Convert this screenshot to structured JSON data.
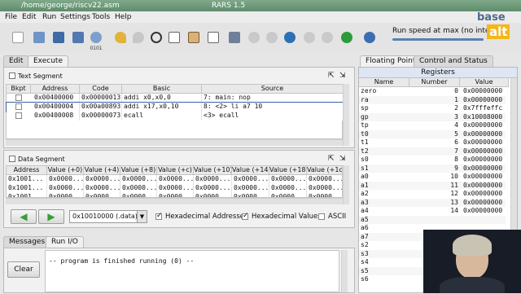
{
  "window": {
    "title": "RARS 1.5",
    "file_path": "/home/george/riscv22.asm"
  },
  "menu": [
    "File",
    "Edit",
    "Run",
    "Settings",
    "Tools",
    "Help"
  ],
  "toolbar": {
    "dump_label": "0101",
    "speed_label": "Run speed at max (no inte",
    "logo_top": "base",
    "logo_bottom": "alt"
  },
  "tabs": {
    "edit": "Edit",
    "execute": "Execute"
  },
  "text_segment": {
    "title": "Text Segment",
    "columns": [
      "Bkpt",
      "Address",
      "Code",
      "Basic",
      "Source"
    ],
    "rows": [
      {
        "address": "0x00400000",
        "code": "0x00000013",
        "basic": "addi x0,x0,0",
        "source": "7: main:   nop"
      },
      {
        "address": "0x00400004",
        "code": "0x00a00893",
        "basic": "addi x17,x0,10",
        "source": "8: <2> li  a7 10"
      },
      {
        "address": "0x00400008",
        "code": "0x00000073",
        "basic": "ecall",
        "source": "   <3> ecall"
      }
    ]
  },
  "data_segment": {
    "title": "Data Segment",
    "columns": [
      "Address",
      "Value (+0)",
      "Value (+4)",
      "Value (+8)",
      "Value (+c)",
      "Value (+10)",
      "Value (+14)",
      "Value (+18)",
      "Value (+1c)"
    ],
    "rows": [
      [
        "0x1001...",
        "0x0000...",
        "0x0000...",
        "0x0000...",
        "0x0000...",
        "0x0000...",
        "0x0000...",
        "0x0000...",
        "0x0000..."
      ],
      [
        "0x1001...",
        "0x0000...",
        "0x0000...",
        "0x0000...",
        "0x0000...",
        "0x0000...",
        "0x0000...",
        "0x0000...",
        "0x0000..."
      ],
      [
        "0x1001...",
        "0x0000...",
        "0x0000...",
        "0x0000...",
        "0x0000...",
        "0x0000...",
        "0x0000...",
        "0x0000...",
        "0x0000..."
      ]
    ],
    "address_select": "0x10010000 (.data)",
    "hex_addresses_label": "Hexadecimal Addresses",
    "hex_values_label": "Hexadecimal Values",
    "ascii_label": "ASCII"
  },
  "bottom": {
    "tabs": [
      "Messages",
      "Run I/O"
    ],
    "clear_label": "Clear",
    "output": "-- program is finished running (0) --"
  },
  "registers": {
    "tabs": [
      "Floating Point",
      "Control and Status"
    ],
    "header": "Registers",
    "columns": [
      "Name",
      "Number",
      "Value"
    ],
    "rows": [
      {
        "name": "zero",
        "number": "0",
        "value": "0x00000000"
      },
      {
        "name": "ra",
        "number": "1",
        "value": "0x00000000"
      },
      {
        "name": "sp",
        "number": "2",
        "value": "0x7fffeffc"
      },
      {
        "name": "gp",
        "number": "3",
        "value": "0x10008000"
      },
      {
        "name": "tp",
        "number": "4",
        "value": "0x00000000"
      },
      {
        "name": "t0",
        "number": "5",
        "value": "0x00000000"
      },
      {
        "name": "t1",
        "number": "6",
        "value": "0x00000000"
      },
      {
        "name": "t2",
        "number": "7",
        "value": "0x00000000"
      },
      {
        "name": "s0",
        "number": "8",
        "value": "0x00000000"
      },
      {
        "name": "s1",
        "number": "9",
        "value": "0x00000000"
      },
      {
        "name": "a0",
        "number": "10",
        "value": "0x00000000"
      },
      {
        "name": "a1",
        "number": "11",
        "value": "0x00000000"
      },
      {
        "name": "a2",
        "number": "12",
        "value": "0x00000000"
      },
      {
        "name": "a3",
        "number": "13",
        "value": "0x00000000"
      },
      {
        "name": "a4",
        "number": "14",
        "value": "0x00000000"
      },
      {
        "name": "a5",
        "number": "",
        "value": ""
      },
      {
        "name": "a6",
        "number": "",
        "value": ""
      },
      {
        "name": "a7",
        "number": "",
        "value": ""
      },
      {
        "name": "s2",
        "number": "",
        "value": ""
      },
      {
        "name": "s3",
        "number": "",
        "value": ""
      },
      {
        "name": "s4",
        "number": "",
        "value": ""
      },
      {
        "name": "s5",
        "number": "",
        "value": ""
      },
      {
        "name": "s6",
        "number": "",
        "value": ""
      }
    ]
  }
}
